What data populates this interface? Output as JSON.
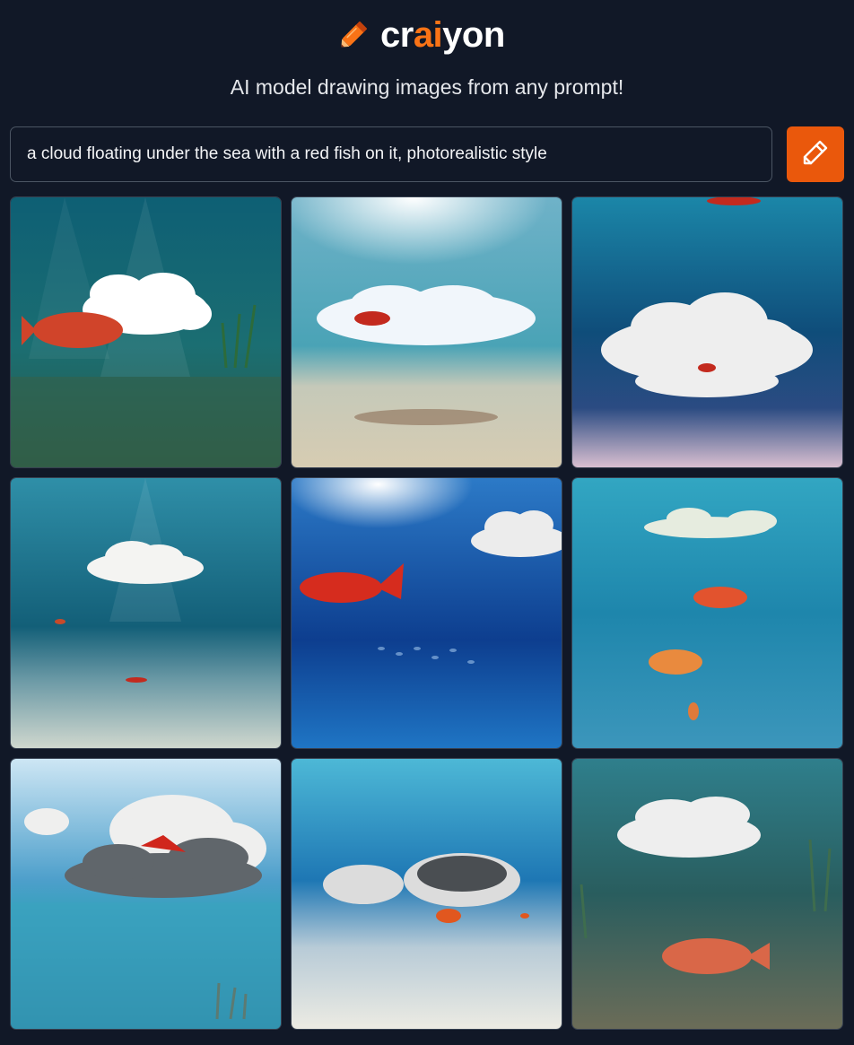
{
  "brand": {
    "logo_prefix": "cr",
    "logo_highlight": "ai",
    "logo_suffix": "yon",
    "accent": "#f97316",
    "button_color": "#ea580c"
  },
  "tagline": "AI model drawing images from any prompt!",
  "prompt": {
    "value": "a cloud floating under the sea with a red fish on it, photorealistic style"
  },
  "draw_button": {
    "icon": "pencil-icon"
  },
  "results": [
    {
      "name": "result-image-1"
    },
    {
      "name": "result-image-2"
    },
    {
      "name": "result-image-3"
    },
    {
      "name": "result-image-4"
    },
    {
      "name": "result-image-5"
    },
    {
      "name": "result-image-6"
    },
    {
      "name": "result-image-7"
    },
    {
      "name": "result-image-8"
    },
    {
      "name": "result-image-9"
    }
  ]
}
